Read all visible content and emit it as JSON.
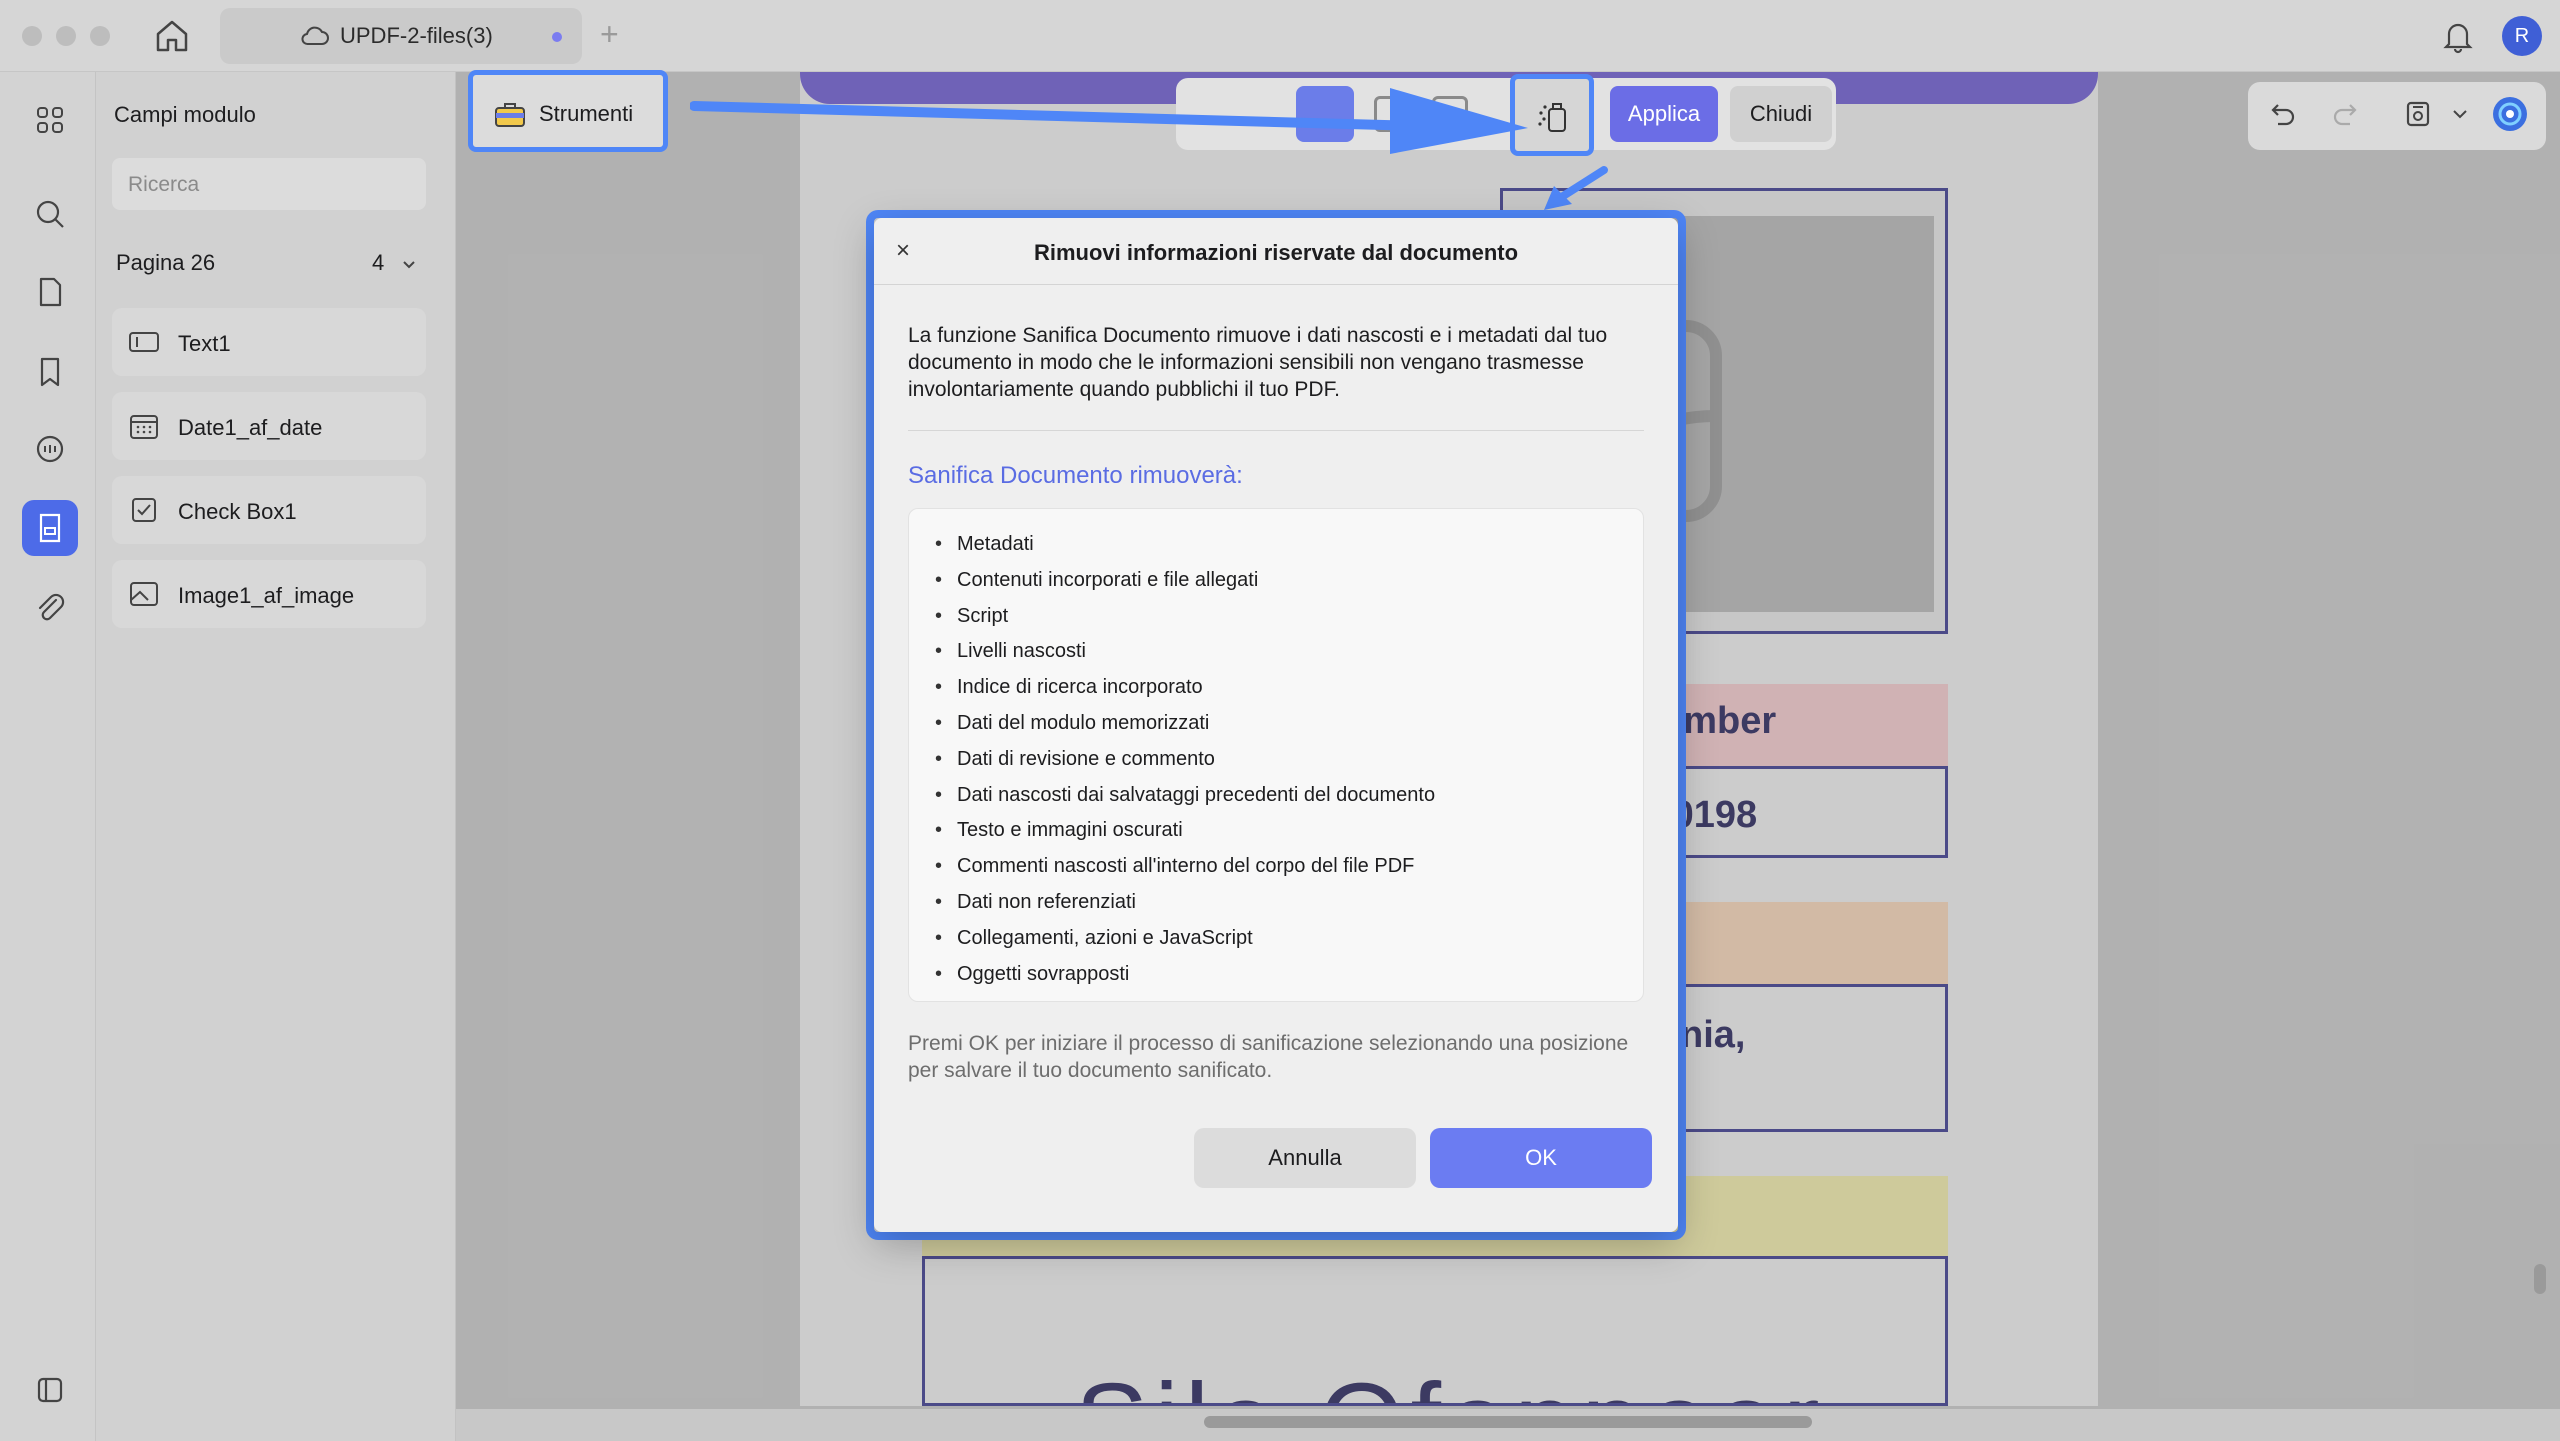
{
  "titlebar": {
    "tab_title": "UPDF-2-files(3)",
    "add_tab": "+",
    "avatar_initial": "R"
  },
  "rail": {
    "icons": [
      "apps-grid-icon",
      "search-icon",
      "page-icon",
      "bookmark-icon",
      "comment-icon",
      "form-icon",
      "attachment-icon",
      "sidebar-toggle-icon"
    ],
    "active_icon": "form-icon"
  },
  "panel": {
    "title": "Campi modulo",
    "search_placeholder": "Ricerca",
    "page_label": "Pagina 26",
    "page_count": "4",
    "fields": [
      {
        "label": "Text1",
        "icon": "text-field-icon"
      },
      {
        "label": "Date1_af_date",
        "icon": "calendar-icon"
      },
      {
        "label": "Check Box1",
        "icon": "checkbox-icon"
      },
      {
        "label": "Image1_af_image",
        "icon": "image-icon"
      }
    ]
  },
  "toolbar": {
    "tools_label": "Strumenti",
    "apply_label": "Applica",
    "close_label": "Chiudi"
  },
  "document": {
    "fragment_1": "umber",
    "fragment_2": "-0198",
    "fragment_3": "nia,",
    "fragment_4": "Sila Ofannaar"
  },
  "dialog": {
    "close": "×",
    "title": "Rimuovi informazioni riservate dal documento",
    "description": "La funzione Sanifica Documento rimuove i dati nascosti e i metadati dal tuo documento in modo che le informazioni sensibili non vengano trasmesse involontariamente quando pubblichi il tuo PDF.",
    "subtitle": "Sanifica Documento rimuoverà:",
    "items": [
      "Metadati",
      "Contenuti incorporati e file allegati",
      "Script",
      "Livelli nascosti",
      "Indice di ricerca incorporato",
      "Dati del modulo memorizzati",
      "Dati di revisione e commento",
      "Dati nascosti dai salvataggi precedenti del documento",
      "Testo e immagini oscurati",
      "Commenti nascosti all'interno del corpo del file PDF",
      "Dati non referenziati",
      "Collegamenti, azioni e JavaScript",
      "Oggetti sovrapposti"
    ],
    "note": "Premi OK per iniziare il processo di sanificazione selezionando una posizione per salvare il tuo documento sanificato.",
    "cancel_label": "Annulla",
    "ok_label": "OK"
  },
  "colors": {
    "accent": "#4f86f7",
    "primary_button": "#6b7cf2",
    "subtitle": "#5a6ce3"
  }
}
